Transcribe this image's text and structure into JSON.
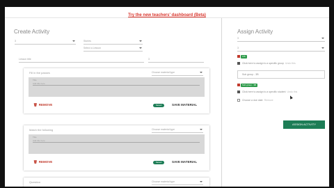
{
  "banner": {
    "link": "Try the new teachers' dashboard (Beta)"
  },
  "create": {
    "title": "Create Activity",
    "sel1": "3",
    "sel2": "Stories",
    "sel3": "Select a Lesson",
    "sel4": "Lesson title",
    "sel5": "3"
  },
  "cards": [
    {
      "title": "Fill in the passes",
      "type": "Choose material type",
      "label": "Title",
      "placeholder": "Add title here",
      "remove": "REMOVE",
      "status": "Saved",
      "save": "SAVE MATERIAL"
    },
    {
      "title": "Match the following",
      "type": "Choose material type",
      "label": "Title",
      "placeholder": "Add title here",
      "remove": "REMOVE",
      "status": "Saved",
      "save": "SAVE MATERIAL"
    },
    {
      "title": "Question",
      "type": "Choose material type"
    }
  ],
  "assign": {
    "title": "Assign Activity",
    "sel1": "3",
    "sel2": "3",
    "tag1": "3 B",
    "row1": "Click here to assign to a specific group",
    "row1_link": "Undo this",
    "group_value": "Sub group - 3B",
    "tag2": "Sub group - 3B",
    "row2": "Click here to assign to a specific student",
    "row2_link": "Undo this",
    "row3": "Choose a due date",
    "row3_link": "Remove",
    "button": "ASSIGN ACTIVITY"
  }
}
